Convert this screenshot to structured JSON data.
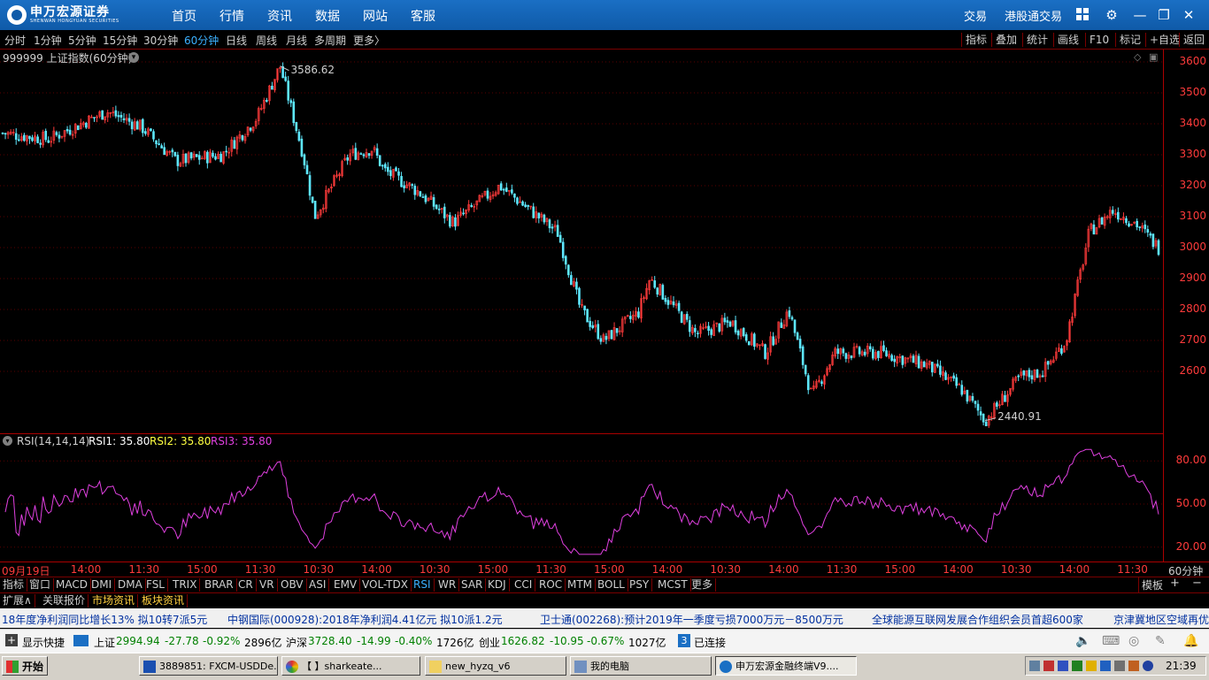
{
  "app": {
    "logo_text": "申万宏源证券",
    "logo_subtext": "SHENWAN HONGYUAN SECURITIES",
    "nav": [
      "首页",
      "行情",
      "资讯",
      "数据",
      "网站",
      "客服"
    ],
    "right_links": [
      "交易",
      "港股通交易"
    ]
  },
  "periods": [
    "分时",
    "1分钟",
    "5分钟",
    "15分钟",
    "30分钟",
    "60分钟",
    "日线",
    "周线",
    "月线",
    "多周期",
    "更多〉"
  ],
  "active_period": "60分钟",
  "right_tools": [
    "指标",
    "叠加",
    "统计",
    "画线",
    "F10",
    "标记",
    "+自选",
    "返回"
  ],
  "main_chart": {
    "title": "999999 上证指数(60分钟)",
    "high_label": "3586.62",
    "low_label": "2440.91",
    "y_ticks": [
      "3600",
      "3500",
      "3400",
      "3300",
      "3200",
      "3100",
      "3000",
      "2900",
      "2800",
      "2700",
      "2600"
    ],
    "up_color": "#ff3b3b",
    "down_color": "#5ee8ff"
  },
  "rsi": {
    "title": "RSI(14,14,14)",
    "rsi1": "RSI1: 35.80",
    "rsi2": "RSI2: 35.80",
    "rsi3": "RSI3: 35.80",
    "y_ticks": [
      "80.00",
      "50.00",
      "20.00"
    ],
    "line_color": "#e040e0"
  },
  "chart_data": {
    "type": "candlestick",
    "title": "999999 上证指数(60分钟)",
    "high_marker": 3586.62,
    "low_marker": 2440.91,
    "ylim": [
      2400,
      3640
    ],
    "x_tick_labels": [
      "09月19日",
      "14:00",
      "11:30",
      "15:00",
      "11:30",
      "10:30",
      "14:00",
      "10:30",
      "15:00",
      "11:30",
      "15:00",
      "14:00",
      "10:30",
      "14:00",
      "11:30",
      "15:00",
      "14:00",
      "10:30",
      "14:00",
      "11:30"
    ],
    "trend_points": [
      [
        0,
        3370
      ],
      [
        0.04,
        3350
      ],
      [
        0.09,
        3440
      ],
      [
        0.12,
        3390
      ],
      [
        0.15,
        3280
      ],
      [
        0.19,
        3300
      ],
      [
        0.22,
        3420
      ],
      [
        0.24,
        3586.62
      ],
      [
        0.26,
        3300
      ],
      [
        0.27,
        3100
      ],
      [
        0.3,
        3300
      ],
      [
        0.32,
        3320
      ],
      [
        0.33,
        3250
      ],
      [
        0.36,
        3180
      ],
      [
        0.39,
        3080
      ],
      [
        0.43,
        3200
      ],
      [
        0.46,
        3110
      ],
      [
        0.48,
        3050
      ],
      [
        0.5,
        2800
      ],
      [
        0.52,
        2700
      ],
      [
        0.55,
        2790
      ],
      [
        0.56,
        2900
      ],
      [
        0.6,
        2720
      ],
      [
        0.63,
        2760
      ],
      [
        0.66,
        2660
      ],
      [
        0.68,
        2800
      ],
      [
        0.7,
        2520
      ],
      [
        0.72,
        2660
      ],
      [
        0.76,
        2660
      ],
      [
        0.8,
        2620
      ],
      [
        0.83,
        2540
      ],
      [
        0.85,
        2440.91
      ],
      [
        0.88,
        2580
      ],
      [
        0.9,
        2600
      ],
      [
        0.92,
        2700
      ],
      [
        0.94,
        3050
      ],
      [
        0.96,
        3120
      ],
      [
        0.98,
        3080
      ],
      [
        1,
        3000
      ]
    ],
    "rsi_value": 35.8
  },
  "time_axis_right_label": "60分钟",
  "indicators": [
    "指标",
    "窗口",
    "MACD",
    "DMI",
    "DMA",
    "FSL",
    "TRIX",
    "BRAR",
    "CR",
    "VR",
    "OBV",
    "ASI",
    "EMV",
    "VOL-TDX",
    "RSI",
    "WR",
    "SAR",
    "KDJ",
    "CCI",
    "ROC",
    "MTM",
    "BOLL",
    "PSY",
    "MCST",
    "更多"
  ],
  "active_indicator": "RSI",
  "template_label": "模板",
  "bottom_tabs": [
    "扩展∧",
    "关联报价",
    "市场资讯",
    "板块资讯"
  ],
  "ticker": [
    "18年度净利润同比增长13%  拟10转7派5元",
    "中钢国际(000928):2018年净利润4.41亿元  拟10派1.2元",
    "卫士通(002268):预计2019年一季度亏损7000万元－8500万元",
    "全球能源互联网发展合作组织会员首超600家",
    "京津冀地区空域再优"
  ],
  "status": {
    "shortcut": "显示快捷",
    "sh_name": "上证",
    "sh_val": "2994.94",
    "sh_chg": "-27.78",
    "sh_pct": "-0.92%",
    "sh_amt": "2896亿",
    "sz_name": "沪深",
    "sz_val": "3728.40",
    "sz_chg": "-14.99",
    "sz_pct": "-0.40%",
    "sz_amt": "1726亿",
    "cy_name": "创业",
    "cy_val": "1626.82",
    "cy_chg": "-10.95",
    "cy_pct": "-0.67%",
    "cy_amt": "1027亿",
    "conn_num": "3",
    "conn_text": "已连接"
  },
  "taskbar": {
    "start": "开始",
    "tasks": [
      "3889851: FXCM-USDDe...",
      "【      】sharkeate...",
      "new_hyzq_v6",
      "我的电脑",
      "申万宏源金融终端V9...."
    ],
    "clock": "21:39"
  }
}
